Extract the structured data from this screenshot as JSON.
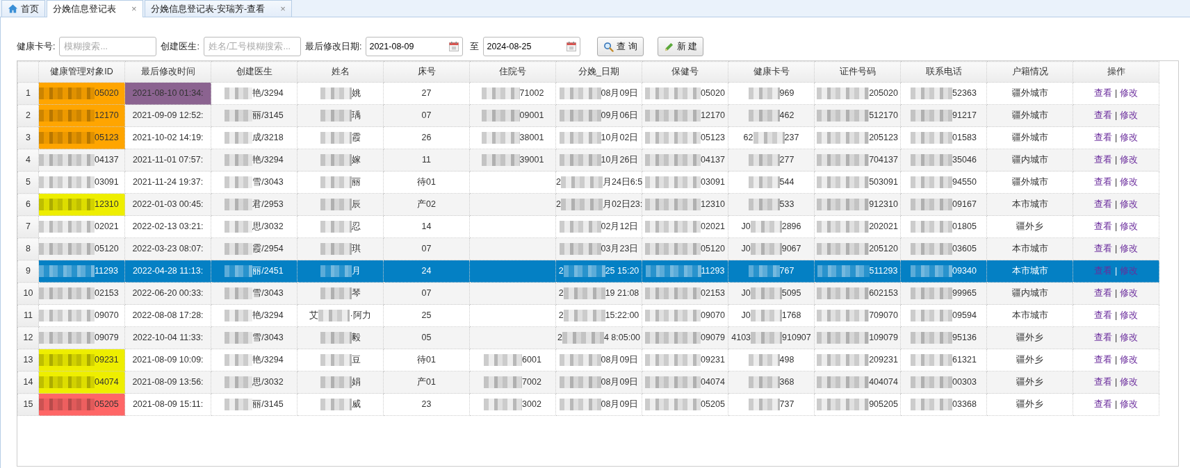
{
  "tabs": [
    {
      "kind": "home",
      "label": "首页",
      "selected": false
    },
    {
      "kind": "page",
      "label": "分娩信息登记表",
      "close": "×",
      "selected": true
    },
    {
      "kind": "page",
      "label": "分娩信息登记表-安瑞芳-查看",
      "close": "×",
      "selected": false
    }
  ],
  "filters": [
    {
      "kind": "text",
      "label": "健康卡号:",
      "placeholder": "模糊搜索..."
    },
    {
      "kind": "text",
      "label": "创建医生:",
      "placeholder": "姓名/工号模糊搜索..."
    },
    {
      "kind": "date",
      "label": "最后修改日期:",
      "value": "2021-08-09"
    },
    {
      "kind": "date",
      "label": "至",
      "value": "2024-08-25"
    }
  ],
  "buttons": [
    {
      "kind": "search",
      "label": "查 询"
    },
    {
      "kind": "new",
      "label": "新 建"
    }
  ],
  "table": {
    "columns": [
      "健康管理对象ID",
      "最后修改时间",
      "创建医生",
      "姓名",
      "床号",
      "住院号",
      "分娩_日期",
      "保健号",
      "健康卡号",
      "证件号码",
      "联系电话",
      "户籍情况",
      "操作"
    ],
    "rows": [
      {
        "no": "1",
        "selected": false,
        "cells": [
          {
            "text": "05020",
            "masked": true,
            "color": "#ffa500"
          },
          {
            "text": "2021-08-10 01:34:",
            "color": "#8b6390"
          },
          {
            "text": "艳/3294",
            "masked": true
          },
          {
            "text": "姚",
            "masked": true
          },
          {
            "text": "27"
          },
          {
            "text": "71002",
            "masked": true
          },
          {
            "text": "08月09日",
            "masked": true
          },
          {
            "text": "05020",
            "masked": true
          },
          {
            "text": "969",
            "masked": true
          },
          {
            "text": "205020",
            "masked": true
          },
          {
            "text": "52363",
            "masked": true
          },
          {
            "text": "疆外城市"
          }
        ],
        "actions": [
          {
            "kind": "link",
            "label": "查看"
          },
          {
            "kind": "separator",
            "label": "|"
          },
          {
            "kind": "link",
            "label": "修改"
          }
        ]
      },
      {
        "no": "2",
        "selected": false,
        "cells": [
          {
            "text": "12170",
            "masked": true,
            "color": "#ffa500"
          },
          {
            "text": "2021-09-09 12:52:"
          },
          {
            "text": "丽/3145",
            "masked": true
          },
          {
            "text": "瑀",
            "masked": true
          },
          {
            "text": "07"
          },
          {
            "text": "09001",
            "masked": true
          },
          {
            "text": "09月06日",
            "masked": true
          },
          {
            "text": "12170",
            "masked": true
          },
          {
            "text": "462",
            "masked": true
          },
          {
            "text": "512170",
            "masked": true
          },
          {
            "text": "91217",
            "masked": true
          },
          {
            "text": "疆外城市"
          }
        ],
        "actions": [
          {
            "kind": "link",
            "label": "查看"
          },
          {
            "kind": "separator",
            "label": "|"
          },
          {
            "kind": "link",
            "label": "修改"
          }
        ]
      },
      {
        "no": "3",
        "selected": false,
        "cells": [
          {
            "text": "05123",
            "masked": true,
            "color": "#ffa500"
          },
          {
            "text": "2021-10-02 14:19:"
          },
          {
            "text": "成/3218",
            "masked": true
          },
          {
            "text": "霞",
            "masked": true
          },
          {
            "text": "26"
          },
          {
            "text": "38001",
            "masked": true
          },
          {
            "text": "10月02日",
            "masked": true
          },
          {
            "text": "05123",
            "masked": true
          },
          {
            "text": "237",
            "masked": true,
            "prefix": "62"
          },
          {
            "text": "205123",
            "masked": true
          },
          {
            "text": "01583",
            "masked": true
          },
          {
            "text": "疆外城市"
          }
        ],
        "actions": [
          {
            "kind": "link",
            "label": "查看"
          },
          {
            "kind": "separator",
            "label": "|"
          },
          {
            "kind": "link",
            "label": "修改"
          }
        ]
      },
      {
        "no": "4",
        "selected": false,
        "cells": [
          {
            "text": "04137",
            "masked": true
          },
          {
            "text": "2021-11-01 07:57:"
          },
          {
            "text": "艳/3294",
            "masked": true
          },
          {
            "text": "嫁",
            "masked": true
          },
          {
            "text": "11"
          },
          {
            "text": "39001",
            "masked": true
          },
          {
            "text": "10月26日",
            "masked": true
          },
          {
            "text": "04137",
            "masked": true
          },
          {
            "text": "277",
            "masked": true
          },
          {
            "text": "704137",
            "masked": true
          },
          {
            "text": "35046",
            "masked": true
          },
          {
            "text": "疆内城市"
          }
        ],
        "actions": [
          {
            "kind": "link",
            "label": "查看"
          },
          {
            "kind": "separator",
            "label": "|"
          },
          {
            "kind": "link",
            "label": "修改"
          }
        ]
      },
      {
        "no": "5",
        "selected": false,
        "cells": [
          {
            "text": "03091",
            "masked": true
          },
          {
            "text": "2021-11-24 19:37:"
          },
          {
            "text": "雪/3043",
            "masked": true
          },
          {
            "text": "丽",
            "masked": true
          },
          {
            "text": "待01"
          },
          {
            "text": ""
          },
          {
            "text": "月24日6:5",
            "masked": true,
            "prefix": "2"
          },
          {
            "text": "03091",
            "masked": true
          },
          {
            "text": "544",
            "masked": true
          },
          {
            "text": "503091",
            "masked": true
          },
          {
            "text": "94550",
            "masked": true
          },
          {
            "text": "疆外城市"
          }
        ],
        "actions": [
          {
            "kind": "link",
            "label": "查看"
          },
          {
            "kind": "separator",
            "label": "|"
          },
          {
            "kind": "link",
            "label": "修改"
          }
        ]
      },
      {
        "no": "6",
        "selected": false,
        "cells": [
          {
            "text": "12310",
            "masked": true,
            "color": "#eeee00"
          },
          {
            "text": "2022-01-03 00:45:"
          },
          {
            "text": "君/2953",
            "masked": true
          },
          {
            "text": "辰",
            "masked": true
          },
          {
            "text": "产02"
          },
          {
            "text": ""
          },
          {
            "text": "月02日23:",
            "masked": true,
            "prefix": "2"
          },
          {
            "text": "12310",
            "masked": true
          },
          {
            "text": "533",
            "masked": true
          },
          {
            "text": "912310",
            "masked": true
          },
          {
            "text": "09167",
            "masked": true
          },
          {
            "text": "本市城市"
          }
        ],
        "actions": [
          {
            "kind": "link",
            "label": "查看"
          },
          {
            "kind": "separator",
            "label": "|"
          },
          {
            "kind": "link",
            "label": "修改"
          }
        ]
      },
      {
        "no": "7",
        "selected": false,
        "cells": [
          {
            "text": "02021",
            "masked": true
          },
          {
            "text": "2022-02-13 03:21:"
          },
          {
            "text": "思/3032",
            "masked": true
          },
          {
            "text": "忍",
            "masked": true
          },
          {
            "text": "14"
          },
          {
            "text": ""
          },
          {
            "text": "02月12日",
            "masked": true
          },
          {
            "text": "02021",
            "masked": true
          },
          {
            "text": "2896",
            "masked": true,
            "prefix": "J0"
          },
          {
            "text": "202021",
            "masked": true
          },
          {
            "text": "01805",
            "masked": true
          },
          {
            "text": "疆外乡"
          }
        ],
        "actions": [
          {
            "kind": "link",
            "label": "查看"
          },
          {
            "kind": "separator",
            "label": "|"
          },
          {
            "kind": "link",
            "label": "修改"
          }
        ]
      },
      {
        "no": "8",
        "selected": false,
        "cells": [
          {
            "text": "05120",
            "masked": true
          },
          {
            "text": "2022-03-23 08:07:"
          },
          {
            "text": "霞/2954",
            "masked": true
          },
          {
            "text": "琪",
            "masked": true
          },
          {
            "text": "07"
          },
          {
            "text": ""
          },
          {
            "text": "03月23日",
            "masked": true
          },
          {
            "text": "05120",
            "masked": true
          },
          {
            "text": "9067",
            "masked": true,
            "prefix": "J0"
          },
          {
            "text": "205120",
            "masked": true
          },
          {
            "text": "03605",
            "masked": true
          },
          {
            "text": "本市城市"
          }
        ],
        "actions": [
          {
            "kind": "link",
            "label": "查看"
          },
          {
            "kind": "separator",
            "label": "|"
          },
          {
            "kind": "link",
            "label": "修改"
          }
        ]
      },
      {
        "no": "9",
        "selected": true,
        "cells": [
          {
            "text": "11293",
            "masked": true
          },
          {
            "text": "2022-04-28 11:13:"
          },
          {
            "text": "丽/2451",
            "masked": true
          },
          {
            "text": "月",
            "masked": true
          },
          {
            "text": "24"
          },
          {
            "text": ""
          },
          {
            "text": "25 15:20",
            "masked": true,
            "prefix": "2"
          },
          {
            "text": "11293",
            "masked": true
          },
          {
            "text": "767",
            "masked": true
          },
          {
            "text": "511293",
            "masked": true
          },
          {
            "text": "09340",
            "masked": true
          },
          {
            "text": "本市城市"
          }
        ],
        "actions": [
          {
            "kind": "link",
            "label": "查看"
          },
          {
            "kind": "separator",
            "label": "|"
          },
          {
            "kind": "link",
            "label": "修改"
          }
        ]
      },
      {
        "no": "10",
        "selected": false,
        "cells": [
          {
            "text": "02153",
            "masked": true
          },
          {
            "text": "2022-06-20 00:33:"
          },
          {
            "text": "雪/3043",
            "masked": true
          },
          {
            "text": "琴",
            "masked": true
          },
          {
            "text": "07"
          },
          {
            "text": ""
          },
          {
            "text": "19 21:08",
            "masked": true,
            "prefix": "2"
          },
          {
            "text": "02153",
            "masked": true
          },
          {
            "text": "5095",
            "masked": true,
            "prefix": "J0"
          },
          {
            "text": "602153",
            "masked": true
          },
          {
            "text": "99965",
            "masked": true
          },
          {
            "text": "疆内城市"
          }
        ],
        "actions": [
          {
            "kind": "link",
            "label": "查看"
          },
          {
            "kind": "separator",
            "label": "|"
          },
          {
            "kind": "link",
            "label": "修改"
          }
        ]
      },
      {
        "no": "11",
        "selected": false,
        "cells": [
          {
            "text": "09070",
            "masked": true
          },
          {
            "text": "2022-08-08 17:28:"
          },
          {
            "text": "艳/3294",
            "masked": true
          },
          {
            "text": "·阿力",
            "masked": true,
            "prefix": "艾"
          },
          {
            "text": "25"
          },
          {
            "text": ""
          },
          {
            "text": "15:22:00",
            "masked": true,
            "prefix": "2"
          },
          {
            "text": "09070",
            "masked": true
          },
          {
            "text": "1768",
            "masked": true,
            "prefix": "J0"
          },
          {
            "text": "709070",
            "masked": true
          },
          {
            "text": "09594",
            "masked": true
          },
          {
            "text": "本市城市"
          }
        ],
        "actions": [
          {
            "kind": "link",
            "label": "查看"
          },
          {
            "kind": "separator",
            "label": "|"
          },
          {
            "kind": "link",
            "label": "修改"
          }
        ]
      },
      {
        "no": "12",
        "selected": false,
        "cells": [
          {
            "text": "09079",
            "masked": true
          },
          {
            "text": "2022-10-04 11:33:"
          },
          {
            "text": "雪/3043",
            "masked": true
          },
          {
            "text": "毅",
            "masked": true
          },
          {
            "text": "05"
          },
          {
            "text": ""
          },
          {
            "text": "4 8:05:00",
            "masked": true,
            "prefix": "2"
          },
          {
            "text": "09079",
            "masked": true
          },
          {
            "text": "910907",
            "masked": true,
            "prefix": "4103"
          },
          {
            "text": "109079",
            "masked": true
          },
          {
            "text": "95136",
            "masked": true
          },
          {
            "text": "疆外乡"
          }
        ],
        "actions": [
          {
            "kind": "link",
            "label": "查看"
          },
          {
            "kind": "separator",
            "label": "|"
          },
          {
            "kind": "link",
            "label": "修改"
          }
        ]
      },
      {
        "no": "13",
        "selected": false,
        "cells": [
          {
            "text": "09231",
            "masked": true,
            "color": "#eeee00"
          },
          {
            "text": "2021-08-09 10:09:"
          },
          {
            "text": "艳/3294",
            "masked": true
          },
          {
            "text": "豆",
            "masked": true
          },
          {
            "text": "待01"
          },
          {
            "text": "6001",
            "masked": true
          },
          {
            "text": "08月09日",
            "masked": true
          },
          {
            "text": "09231",
            "masked": true
          },
          {
            "text": "498",
            "masked": true
          },
          {
            "text": "209231",
            "masked": true
          },
          {
            "text": "61321",
            "masked": true
          },
          {
            "text": "疆外乡"
          }
        ],
        "actions": [
          {
            "kind": "link",
            "label": "查看"
          },
          {
            "kind": "separator",
            "label": "|"
          },
          {
            "kind": "link",
            "label": "修改"
          }
        ]
      },
      {
        "no": "14",
        "selected": false,
        "cells": [
          {
            "text": "04074",
            "masked": true,
            "color": "#eeee00"
          },
          {
            "text": "2021-08-09 13:56:"
          },
          {
            "text": "思/3032",
            "masked": true
          },
          {
            "text": "娟",
            "masked": true
          },
          {
            "text": "产01"
          },
          {
            "text": "7002",
            "masked": true
          },
          {
            "text": "08月09日",
            "masked": true
          },
          {
            "text": "04074",
            "masked": true
          },
          {
            "text": "368",
            "masked": true
          },
          {
            "text": "404074",
            "masked": true
          },
          {
            "text": "00303",
            "masked": true
          },
          {
            "text": "疆外乡"
          }
        ],
        "actions": [
          {
            "kind": "link",
            "label": "查看"
          },
          {
            "kind": "separator",
            "label": "|"
          },
          {
            "kind": "link",
            "label": "修改"
          }
        ]
      },
      {
        "no": "15",
        "selected": false,
        "cells": [
          {
            "text": "05205",
            "masked": true,
            "color": "#ff6666"
          },
          {
            "text": "2021-08-09 15:11:"
          },
          {
            "text": "丽/3145",
            "masked": true
          },
          {
            "text": "威",
            "masked": true
          },
          {
            "text": "23"
          },
          {
            "text": "3002",
            "masked": true
          },
          {
            "text": "08月09日",
            "masked": true
          },
          {
            "text": "05205",
            "masked": true
          },
          {
            "text": "737",
            "masked": true
          },
          {
            "text": "905205",
            "masked": true
          },
          {
            "text": "03368",
            "masked": true
          },
          {
            "text": "疆外乡"
          }
        ],
        "actions": [
          {
            "kind": "link",
            "label": "查看"
          },
          {
            "kind": "separator",
            "label": "|"
          },
          {
            "kind": "link",
            "label": "修改"
          }
        ]
      }
    ]
  }
}
